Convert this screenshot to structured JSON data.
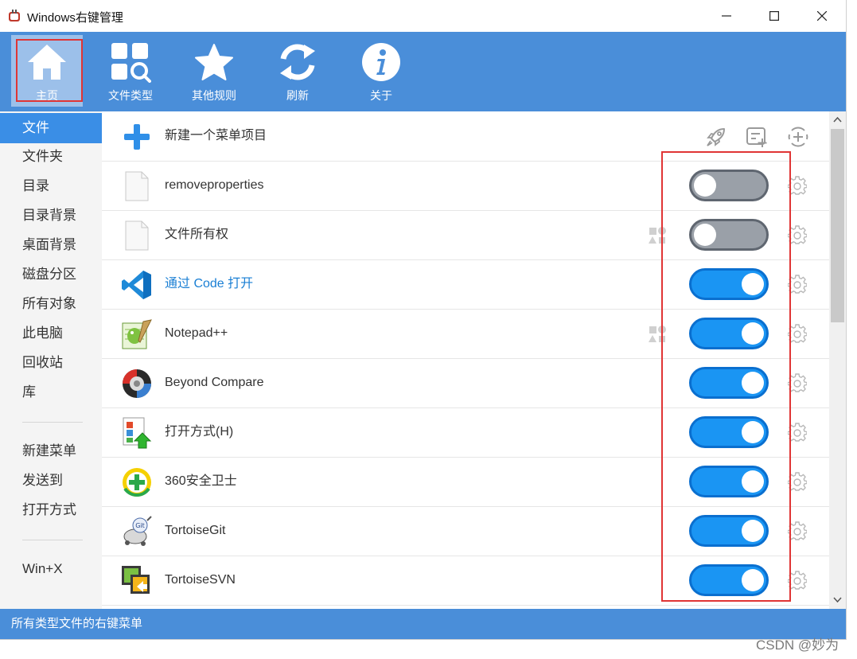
{
  "window": {
    "title": "Windows右键管理",
    "controls": [
      "minimize",
      "maximize",
      "close"
    ]
  },
  "toolbar": {
    "items": [
      {
        "label": "主页",
        "icon": "home-icon"
      },
      {
        "label": "文件类型",
        "icon": "file-types-search-icon"
      },
      {
        "label": "其他规则",
        "icon": "star-icon"
      },
      {
        "label": "刷新",
        "icon": "refresh-icon"
      },
      {
        "label": "关于",
        "icon": "info-icon"
      }
    ],
    "active": "主页"
  },
  "sidebar": {
    "items": [
      "文件",
      "文件夹",
      "目录",
      "目录背景",
      "桌面背景",
      "磁盘分区",
      "所有对象",
      "此电脑",
      "回收站",
      "库"
    ],
    "items2": [
      "新建菜单",
      "发送到",
      "打开方式"
    ],
    "items3": [
      "Win+X"
    ],
    "selected": "文件"
  },
  "content": {
    "new_item_label": "新建一个菜单项目",
    "header_icons": [
      "rocket-icon",
      "add-list-icon",
      "add-circle-icon"
    ],
    "rows": [
      {
        "label": "removeproperties",
        "icon": "blank-file-icon",
        "enabled": false,
        "shapes": false
      },
      {
        "label": "文件所有权",
        "icon": "blank-file-icon",
        "enabled": false,
        "shapes": true
      },
      {
        "label": "通过 Code 打开",
        "icon": "vscode-icon",
        "enabled": true,
        "shapes": false,
        "link": true
      },
      {
        "label": "Notepad++",
        "icon": "notepadpp-icon",
        "enabled": true,
        "shapes": true
      },
      {
        "label": "Beyond Compare",
        "icon": "beyond-compare-icon",
        "enabled": true,
        "shapes": false
      },
      {
        "label": "打开方式(H)",
        "icon": "open-with-icon",
        "enabled": true,
        "shapes": false
      },
      {
        "label": "360安全卫士",
        "icon": "360-icon",
        "enabled": true,
        "shapes": false
      },
      {
        "label": "TortoiseGit",
        "icon": "tortoisegit-icon",
        "enabled": true,
        "shapes": false
      },
      {
        "label": "TortoiseSVN",
        "icon": "tortoisesvn-icon",
        "enabled": true,
        "shapes": false
      }
    ]
  },
  "status": {
    "text": "所有类型文件的右键菜单"
  },
  "watermark": "CSDN @妙为",
  "colors": {
    "accent": "#4a8ed9",
    "toggle_on": "#1a95f3",
    "toggle_off": "#9aa0a8",
    "highlight": "#e03535"
  }
}
